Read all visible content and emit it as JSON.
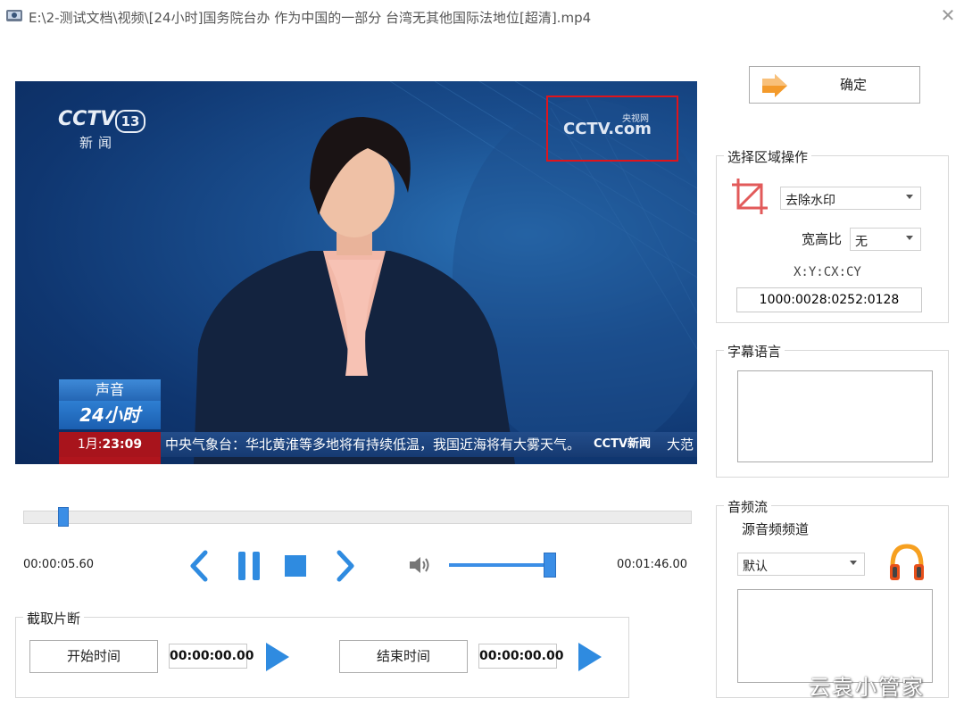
{
  "window": {
    "title": "E:\\2-测试文档\\视频\\[24小时]国务院台办 作为中国的一部分 台湾无其他国际法地位[超清].mp4",
    "close_glyph": "✕"
  },
  "video": {
    "channel_logo": "CCTV",
    "channel_number": "13",
    "channel_name": "新闻",
    "watermark_cn": "央视网",
    "watermark_text": "CCTV.com",
    "badge_top": "声音",
    "badge_mid": "24小时",
    "date_month": "1月:",
    "date_time": "23:09",
    "ticker_text": "中央气象台：华北黄淮等多地将有持续低温，我国近海将有大雾天气。",
    "ticker_logo": "CCTV新闻",
    "ticker_more": "大范"
  },
  "playback": {
    "current_time": "00:00:05.60",
    "total_time": "00:01:46.00",
    "progress_fraction": 0.053,
    "volume_fraction": 0.93
  },
  "clip": {
    "group_title": "截取片断",
    "start_button": "开始时间",
    "start_value": "00:00:00.00",
    "end_button": "结束时间",
    "end_value": "00:00:00.00"
  },
  "confirm_button": "确定",
  "region": {
    "group_title": "选择区域操作",
    "operation_value": "去除水印",
    "aspect_label": "宽高比",
    "aspect_value": "无",
    "coords_label": "X:Y:CX:CY",
    "coords_value": "1000:0028:0252:0128"
  },
  "subtitle": {
    "group_title": "字幕语言"
  },
  "audio": {
    "group_title": "音频流",
    "source_label": "源音频频道",
    "source_value": "默认"
  },
  "footer_watermark": "云袁小管家",
  "colors": {
    "accent_blue": "#3b8ee6",
    "highlight_red": "#e0141b",
    "arrow_orange": "#f39a2b"
  }
}
